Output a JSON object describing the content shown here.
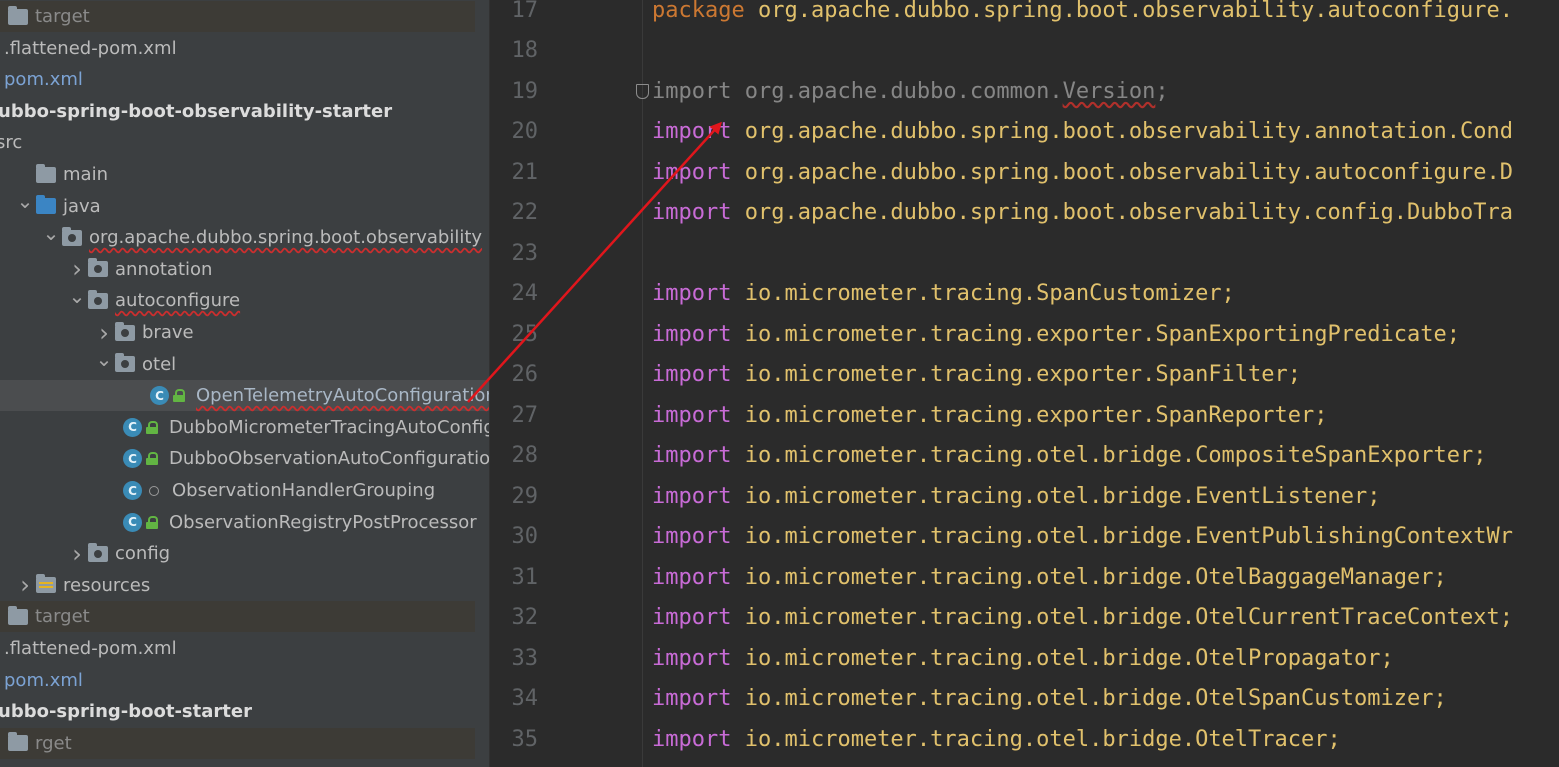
{
  "tree": [
    {
      "label": "target",
      "kind": "folder",
      "indent": -14,
      "state": "none",
      "excluded": true
    },
    {
      "label": ".flattened-pom.xml",
      "kind": "xml",
      "indent": -6
    },
    {
      "label": "pom.xml",
      "kind": "pom",
      "indent": -6
    },
    {
      "label": "ubbo-spring-boot-observability-starter",
      "kind": "module",
      "indent": -4,
      "bold": true
    },
    {
      "label": "src",
      "kind": "tick",
      "indent": -14
    },
    {
      "label": "main",
      "kind": "folder",
      "indent": 8,
      "state": "none"
    },
    {
      "label": "java",
      "kind": "folder-blue",
      "indent": 8,
      "state": "open"
    },
    {
      "label": "org.apache.dubbo.spring.boot.observability",
      "kind": "package",
      "indent": 34,
      "state": "open",
      "underline": true
    },
    {
      "label": "annotation",
      "kind": "package",
      "indent": 60,
      "state": "closed"
    },
    {
      "label": "autoconfigure",
      "kind": "package",
      "indent": 60,
      "state": "open",
      "underline": true
    },
    {
      "label": "brave",
      "kind": "package",
      "indent": 87,
      "state": "closed"
    },
    {
      "label": "otel",
      "kind": "package",
      "indent": 87,
      "state": "open"
    },
    {
      "label": "OpenTelemetryAutoConfiguration",
      "kind": "class",
      "indent": 144,
      "selected": true,
      "underline": true
    },
    {
      "label": "DubboMicrometerTracingAutoConfig",
      "kind": "class",
      "indent": 117
    },
    {
      "label": "DubboObservationAutoConfiguration",
      "kind": "class",
      "indent": 117
    },
    {
      "label": "ObservationHandlerGrouping",
      "kind": "class-dot",
      "indent": 117
    },
    {
      "label": "ObservationRegistryPostProcessor",
      "kind": "class",
      "indent": 117
    },
    {
      "label": "config",
      "kind": "package",
      "indent": 60,
      "state": "closed"
    },
    {
      "label": "resources",
      "kind": "resources",
      "indent": 8,
      "state": "closed"
    },
    {
      "label": "target",
      "kind": "folder",
      "indent": -14,
      "state": "none",
      "excluded": true
    },
    {
      "label": ".flattened-pom.xml",
      "kind": "xml",
      "indent": -6
    },
    {
      "label": "pom.xml",
      "kind": "pom",
      "indent": -6
    },
    {
      "label": "ubbo-spring-boot-starter",
      "kind": "module",
      "indent": -4,
      "bold": true
    },
    {
      "label": "rget",
      "kind": "folder",
      "indent": -14,
      "state": "none",
      "excluded": true
    }
  ],
  "editor": {
    "lines": [
      {
        "n": "17",
        "kw": "package",
        "rest": "org.apache.dubbo.spring.boot.observability.autoconfigure."
      },
      {
        "n": "18",
        "kw": "",
        "rest": ""
      },
      {
        "n": "19",
        "kw": "import",
        "rest": "org.apache.dubbo.common.",
        "typo": "Version",
        "tail": ";",
        "unused": true
      },
      {
        "n": "20",
        "kw": "import",
        "rest": "org.apache.dubbo.spring.boot.observability.annotation.Cond"
      },
      {
        "n": "21",
        "kw": "import",
        "rest": "org.apache.dubbo.spring.boot.observability.autoconfigure.D"
      },
      {
        "n": "22",
        "kw": "import",
        "rest": "org.apache.dubbo.spring.boot.observability.config.DubboTra"
      },
      {
        "n": "23",
        "kw": "",
        "rest": ""
      },
      {
        "n": "24",
        "kw": "import",
        "rest": "io.micrometer.tracing.SpanCustomizer;"
      },
      {
        "n": "25",
        "kw": "import",
        "rest": "io.micrometer.tracing.exporter.SpanExportingPredicate;"
      },
      {
        "n": "26",
        "kw": "import",
        "rest": "io.micrometer.tracing.exporter.SpanFilter;"
      },
      {
        "n": "27",
        "kw": "import",
        "rest": "io.micrometer.tracing.exporter.SpanReporter;"
      },
      {
        "n": "28",
        "kw": "import",
        "rest": "io.micrometer.tracing.otel.bridge.CompositeSpanExporter;"
      },
      {
        "n": "29",
        "kw": "import",
        "rest": "io.micrometer.tracing.otel.bridge.EventListener;"
      },
      {
        "n": "30",
        "kw": "import",
        "rest": "io.micrometer.tracing.otel.bridge.EventPublishingContextWr"
      },
      {
        "n": "31",
        "kw": "import",
        "rest": "io.micrometer.tracing.otel.bridge.OtelBaggageManager;"
      },
      {
        "n": "32",
        "kw": "import",
        "rest": "io.micrometer.tracing.otel.bridge.OtelCurrentTraceContext;"
      },
      {
        "n": "33",
        "kw": "import",
        "rest": "io.micrometer.tracing.otel.bridge.OtelPropagator;"
      },
      {
        "n": "34",
        "kw": "import",
        "rest": "io.micrometer.tracing.otel.bridge.OtelSpanCustomizer;"
      },
      {
        "n": "35",
        "kw": "import",
        "rest": "io.micrometer.tracing.otel.bridge.OtelTracer;"
      }
    ]
  },
  "colors": {
    "annotation_arrow": "#e0161c",
    "class_icon": "#3a8bb6",
    "lock": "#62b543",
    "keyword": "#cc7832"
  },
  "icons": {
    "class": "class-c-icon",
    "package": "package-folder-icon",
    "lock": "lock-icon",
    "chevron_open": "chevron-down-icon",
    "chevron_closed": "chevron-right-icon"
  }
}
